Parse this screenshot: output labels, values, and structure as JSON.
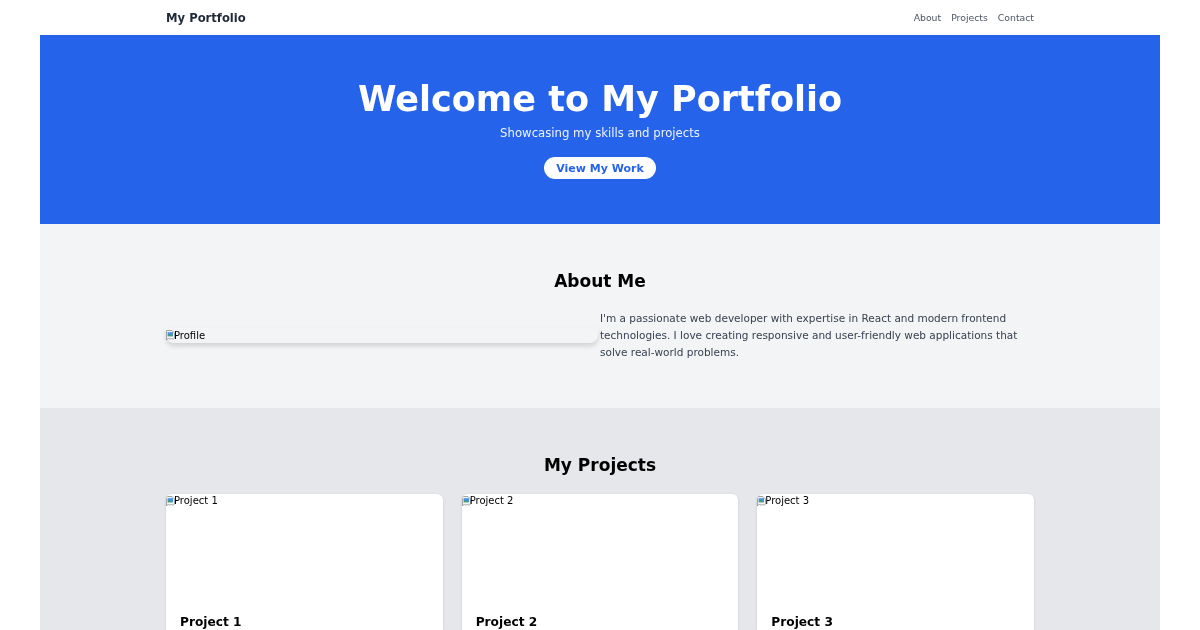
{
  "header": {
    "brand": "My Portfolio",
    "nav": [
      {
        "label": "About"
      },
      {
        "label": "Projects"
      },
      {
        "label": "Contact"
      }
    ]
  },
  "hero": {
    "title": "Welcome to My Portfolio",
    "subtitle": "Showcasing my skills and projects",
    "button": "View My Work"
  },
  "about": {
    "heading": "About Me",
    "image_alt": "Profile",
    "text": "I'm a passionate web developer with expertise in React and modern frontend technologies. I love creating responsive and user-friendly web applications that solve real-world problems."
  },
  "projects": {
    "heading": "My Projects",
    "cards": [
      {
        "image_alt": "Project 1",
        "title": "Project 1"
      },
      {
        "image_alt": "Project 2",
        "title": "Project 2"
      },
      {
        "image_alt": "Project 3",
        "title": "Project 3"
      }
    ]
  }
}
